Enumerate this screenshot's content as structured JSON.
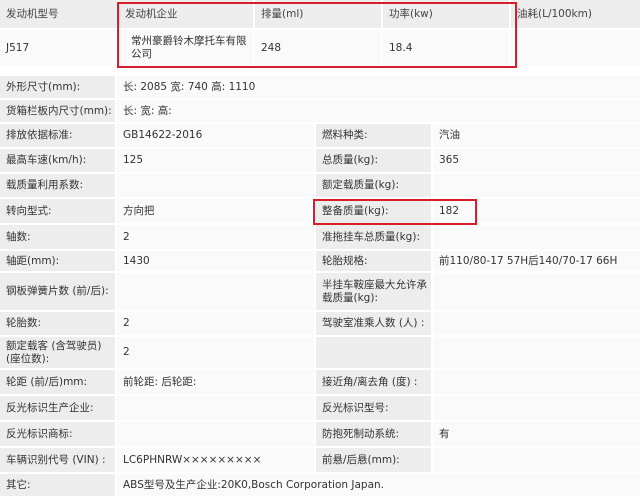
{
  "top": {
    "headers": [
      "发动机型号",
      "发动机企业",
      "排量(ml)",
      "功率(kw)",
      "油耗(L/100km)"
    ],
    "values": [
      "J517",
      "常州豪爵铃木摩托车有限公司",
      "248",
      "18.4",
      ""
    ]
  },
  "specs": [
    {
      "c1": "外形尺寸(mm):",
      "wide": "长: 2085 宽: 740 高: 1110"
    },
    {
      "c1": "货箱栏板内尺寸(mm):",
      "wide": "长:   宽:   高:"
    },
    {
      "c1": "排放依据标准:",
      "c2": "GB14622-2016",
      "c3": "燃料种类:",
      "c4": "汽油"
    },
    {
      "c1": "最高车速(km/h):",
      "c2": "125",
      "c3": "总质量(kg):",
      "c4": "365"
    },
    {
      "c1": "载质量利用系数:",
      "c2": "",
      "c3": "额定载质量(kg):",
      "c4": ""
    },
    {
      "c1": "转向型式:",
      "c2": "方向把",
      "c3": "整备质量(kg):",
      "c4": "182"
    },
    {
      "c1": "轴数:",
      "c2": "2",
      "c3": "准拖挂车总质量(kg):",
      "c4": ""
    },
    {
      "c1": "轴距(mm):",
      "c2": "1430",
      "c3": "轮胎规格:",
      "c4": "前110/80-17 57H后140/70-17 66H"
    },
    {
      "c1": "钢板弹簧片数 (前/后):",
      "c2": "",
      "c3": "半挂车鞍座最大允许承载质量(kg):",
      "c4": ""
    },
    {
      "c1": "轮胎数:",
      "c2": "2",
      "c3": "驾驶室准乘人数 (人) :",
      "c4": ""
    },
    {
      "c1": "额定载客 (含驾驶员) (座位数):",
      "c2": "2",
      "c3": "",
      "c4": ""
    },
    {
      "c1": "轮距 (前/后)mm:",
      "c2": "前轮距: 后轮距:",
      "c3": "接近角/离去角 (度) :",
      "c4": ""
    },
    {
      "c1": "反光标识生产企业:",
      "c2": "",
      "c3": "反光标识型号:",
      "c4": ""
    },
    {
      "c1": "反光标识商标:",
      "c2": "",
      "c3": "防抱死制动系统:",
      "c4": "有"
    },
    {
      "c1": "车辆识别代号 (VIN) :",
      "c2": "LC6PHNRW×××××××××",
      "c3": "前悬/后悬(mm):",
      "c4": ""
    },
    {
      "c1": "其它:",
      "wide": "ABS型号及生产企业:20K0,Bosch Corporation Japan."
    }
  ],
  "colors": {
    "highlight": "#d81e2a",
    "label_bg": "#ededed",
    "value_bg": "#fafafa"
  }
}
